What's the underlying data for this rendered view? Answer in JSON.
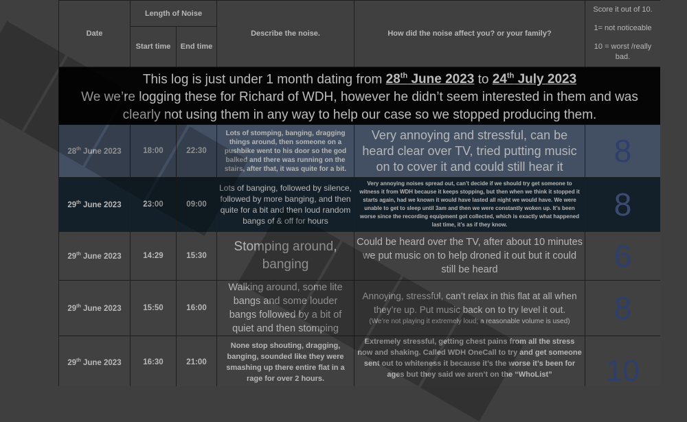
{
  "header": {
    "date": "Date",
    "length_of_noise": "Length of Noise",
    "start_time": "Start time",
    "end_time": "End time",
    "describe": "Describe the noise.",
    "affect": "How did the noise affect you? or your family?",
    "score_title": "Score it out of 10.",
    "score_min": "1= not noticeable",
    "score_max": "10 = worst /really bad."
  },
  "banner": {
    "line1_prefix": "This log is just under 1 month dating from ",
    "start_day": "28",
    "start_suffix": "th",
    "start_rest": " June 2023",
    "to": " to ",
    "end_day": "24",
    "end_suffix": "th",
    "end_rest": " July 2023",
    "line2": "We we’re logging these for Richard of WDH, however he didn’t seem interested in them and was clearly not using them in any way to help our case so we stopped producing them."
  },
  "rows": [
    {
      "day": "28",
      "suffix": "th",
      "month": " June 2023",
      "start": "18:00",
      "end": "22:30",
      "noise": "Lots of stomping, banging, dragging things around, then someone on a pushbike went to his door so the god balked and there was running on the stairs, after that, it was quite for a bit.",
      "effect": "Very annoying and stressful, can be heard clear over TV, tried putting music on to cover it and could still hear it",
      "score": "8"
    },
    {
      "day": "29",
      "suffix": "th",
      "month": " June 2023",
      "start": "23:00",
      "end": "09:00",
      "noise": "Lots of banging, followed by silence, followed by more banging, and then quite for a bit and then loud random bangs of & off for hours",
      "effect": "Very annoying noises spread out, can’t decide if we should try get someone to witness it from WDH because it keeps stopping, but then when we think it stopped it starts again, had we known it would have lasted all night we would have. We were unable to get to sleep until 3am and then we were constantly woken up. It’s been worse since the recording equipment got collected, which is exactly what happened last time, it’s as if they know.",
      "score": "8"
    },
    {
      "day": "29",
      "suffix": "th",
      "month": " June 2023",
      "start": "14:29",
      "end": "15:30",
      "noise": "Stomping around, banging",
      "effect": "Could be heard over the TV, after about 10 minutes we put music on to help droned it out but it could still be heard",
      "score": "6"
    },
    {
      "day": "29",
      "suffix": "th",
      "month": " June 2023",
      "start": "15:50",
      "end": "16:00",
      "noise": "Walking around, some lite bangs and some louder bangs followed by a bit of quiet and then stomping",
      "effect": "Annoying, stressful, can’t relax in this flat at all when they’re up. Put music back on to try level it out.",
      "effect_note": "(We’re not playing it extremely loud; a reasonable volume is used)",
      "score": "8"
    },
    {
      "day": "29",
      "suffix": "th",
      "month": " June 2023",
      "start": "16:30",
      "end": "21:00",
      "noise": "None stop shouting, dragging, banging, sounded like they were smashing up there entire flat in a rage for over 2 hours.",
      "effect": "Extremely stressful, getting chest pains from all the stress now and shaking. Called WDH OneCall to try and get someone sent out to whiteness it because it’s the worse it’s been for ages but they said we aren’t on the “WhoList”",
      "score": "10"
    }
  ]
}
